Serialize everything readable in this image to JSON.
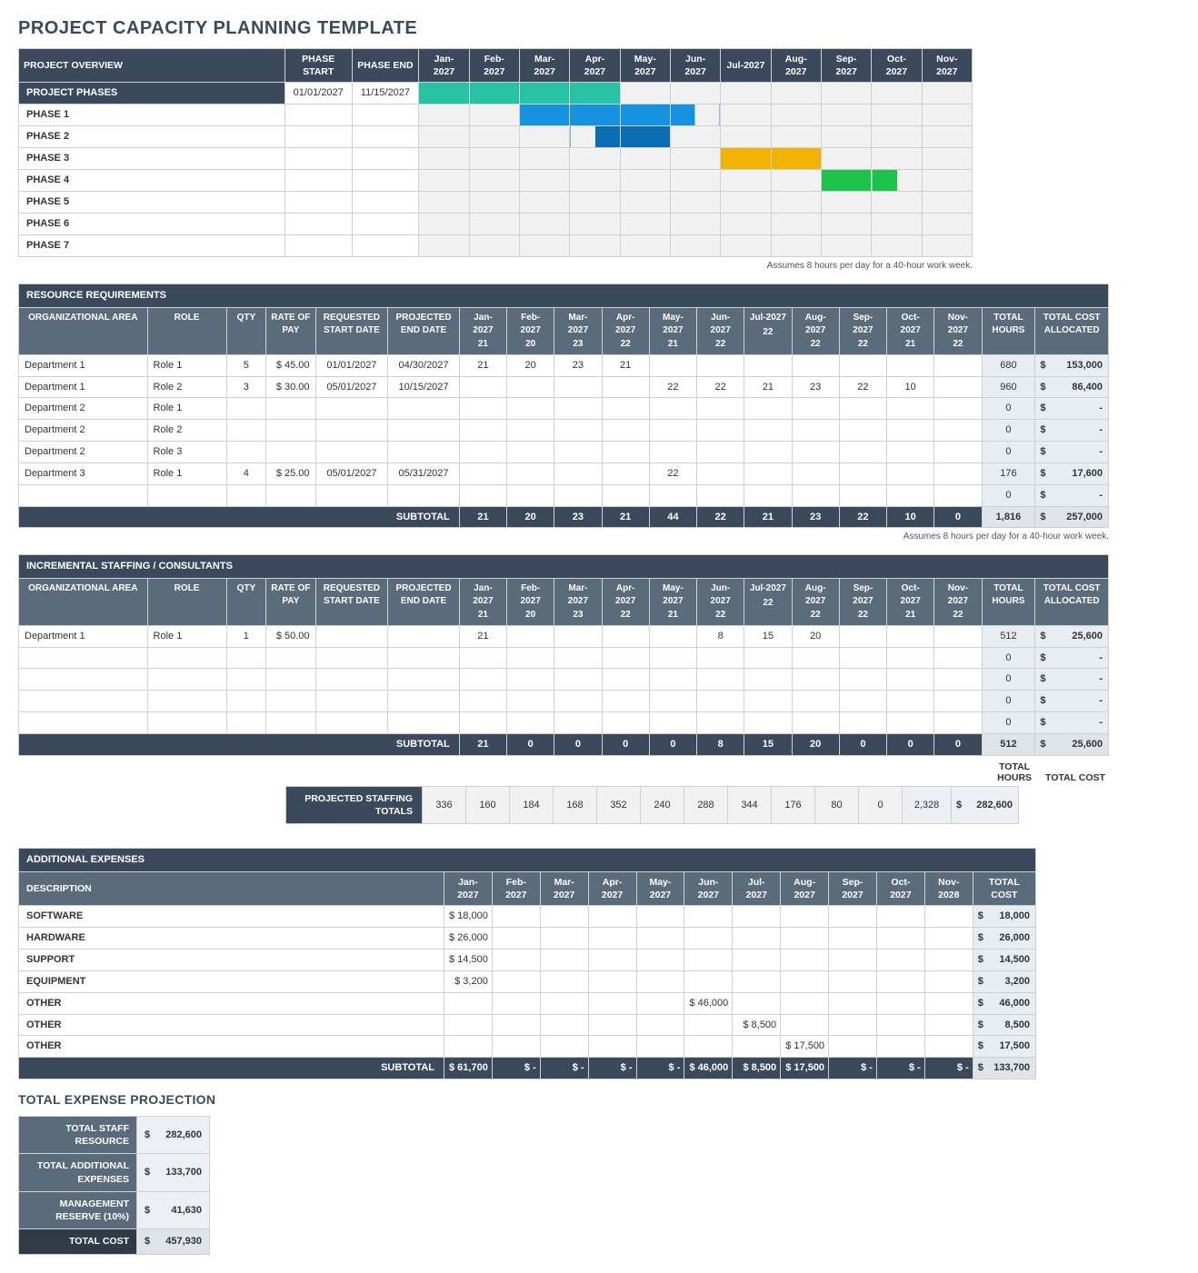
{
  "title": "PROJECT CAPACITY PLANNING TEMPLATE",
  "note": "Assumes 8 hours per day for a 40-hour work week.",
  "overview": {
    "headers": {
      "label": "PROJECT OVERVIEW",
      "phase_start": "PHASE START",
      "phase_end": "PHASE END"
    },
    "months": [
      "Jan-2027",
      "Feb-2027",
      "Mar-2027",
      "Apr-2027",
      "May-2027",
      "Jun-2027",
      "Jul-2027",
      "Aug-2027",
      "Sep-2027",
      "Oct-2027",
      "Nov-2027"
    ],
    "rows": [
      {
        "label": "PROJECT PHASES",
        "pp": true,
        "start": "01/01/2027",
        "end": "11/15/2027",
        "bars": [
          {
            "c": "teal",
            "f": "f"
          },
          {
            "c": "teal",
            "f": "f"
          },
          {
            "c": "teal",
            "f": "f"
          },
          {
            "c": "teal",
            "f": "f"
          },
          null,
          null,
          null,
          null,
          null,
          null,
          null
        ]
      },
      {
        "label": "PHASE 1",
        "bars": [
          null,
          null,
          {
            "c": "blue",
            "f": "f"
          },
          {
            "c": "blue",
            "f": "f"
          },
          {
            "c": "blue",
            "f": "f"
          },
          {
            "c": "blue",
            "f": "hl"
          },
          null,
          null,
          null,
          null,
          null
        ]
      },
      {
        "label": "PHASE 2",
        "bars": [
          null,
          null,
          null,
          {
            "c": "dblue",
            "f": "hr"
          },
          {
            "c": "dblue",
            "f": "f"
          },
          null,
          null,
          null,
          null,
          null,
          null
        ]
      },
      {
        "label": "PHASE 3",
        "bars": [
          null,
          null,
          null,
          null,
          null,
          null,
          {
            "c": "yel",
            "f": "f"
          },
          {
            "c": "yel",
            "f": "f"
          },
          null,
          null,
          null
        ]
      },
      {
        "label": "PHASE 4",
        "bars": [
          null,
          null,
          null,
          null,
          null,
          null,
          null,
          null,
          {
            "c": "grn",
            "f": "f"
          },
          {
            "c": "grn",
            "f": "hl"
          },
          null
        ]
      },
      {
        "label": "PHASE 5",
        "bars": [
          null,
          null,
          null,
          null,
          null,
          null,
          null,
          null,
          null,
          null,
          null
        ]
      },
      {
        "label": "PHASE 6",
        "bars": [
          null,
          null,
          null,
          null,
          null,
          null,
          null,
          null,
          null,
          null,
          null
        ]
      },
      {
        "label": "PHASE 7",
        "bars": [
          null,
          null,
          null,
          null,
          null,
          null,
          null,
          null,
          null,
          null,
          null
        ]
      }
    ]
  },
  "resource": {
    "section": "RESOURCE REQUIREMENTS",
    "headers": {
      "oa": "ORGANIZATIONAL AREA",
      "role": "ROLE",
      "qty": "QTY",
      "rate": "RATE OF PAY",
      "req": "REQUESTED START DATE",
      "proj": "PROJECTED END DATE",
      "th": "TOTAL HOURS",
      "tc": "TOTAL COST ALLOCATED"
    },
    "months": [
      {
        "m": "Jan-2027",
        "d": "21"
      },
      {
        "m": "Feb-2027",
        "d": "20"
      },
      {
        "m": "Mar-2027",
        "d": "23"
      },
      {
        "m": "Apr-2027",
        "d": "22"
      },
      {
        "m": "May-2027",
        "d": "21"
      },
      {
        "m": "Jun-2027",
        "d": "22"
      },
      {
        "m": "Jul-2027",
        "d": "22"
      },
      {
        "m": "Aug-2027",
        "d": "22"
      },
      {
        "m": "Sep-2027",
        "d": "22"
      },
      {
        "m": "Oct-2027",
        "d": "21"
      },
      {
        "m": "Nov-2027",
        "d": "22"
      }
    ],
    "rows": [
      {
        "oa": "Department 1",
        "role": "Role 1",
        "qty": "5",
        "rate": "$ 45.00",
        "req": "01/01/2027",
        "proj": "04/30/2027",
        "m": [
          "21",
          "20",
          "23",
          "21",
          "",
          "",
          "",
          "",
          "",
          "",
          ""
        ],
        "th": "680",
        "tc": "153,000"
      },
      {
        "oa": "Department 1",
        "role": "Role 2",
        "qty": "3",
        "rate": "$ 30.00",
        "req": "05/01/2027",
        "proj": "10/15/2027",
        "m": [
          "",
          "",
          "",
          "",
          "22",
          "22",
          "21",
          "23",
          "22",
          "10",
          ""
        ],
        "th": "960",
        "tc": "86,400"
      },
      {
        "oa": "Department 2",
        "role": "Role 1",
        "qty": "",
        "rate": "",
        "req": "",
        "proj": "",
        "m": [
          "",
          "",
          "",
          "",
          "",
          "",
          "",
          "",
          "",
          "",
          ""
        ],
        "th": "0",
        "tc": "-"
      },
      {
        "oa": "Department 2",
        "role": "Role 2",
        "qty": "",
        "rate": "",
        "req": "",
        "proj": "",
        "m": [
          "",
          "",
          "",
          "",
          "",
          "",
          "",
          "",
          "",
          "",
          ""
        ],
        "th": "0",
        "tc": "-"
      },
      {
        "oa": "Department 2",
        "role": "Role 3",
        "qty": "",
        "rate": "",
        "req": "",
        "proj": "",
        "m": [
          "",
          "",
          "",
          "",
          "",
          "",
          "",
          "",
          "",
          "",
          ""
        ],
        "th": "0",
        "tc": "-"
      },
      {
        "oa": "Department 3",
        "role": "Role 1",
        "qty": "4",
        "rate": "$ 25.00",
        "req": "05/01/2027",
        "proj": "05/31/2027",
        "m": [
          "",
          "",
          "",
          "",
          "22",
          "",
          "",
          "",
          "",
          "",
          ""
        ],
        "th": "176",
        "tc": "17,600"
      },
      {
        "oa": "",
        "role": "",
        "qty": "",
        "rate": "",
        "req": "",
        "proj": "",
        "m": [
          "",
          "",
          "",
          "",
          "",
          "",
          "",
          "",
          "",
          "",
          ""
        ],
        "th": "0",
        "tc": "-"
      }
    ],
    "subtotal": {
      "label": "SUBTOTAL",
      "m": [
        "21",
        "20",
        "23",
        "21",
        "44",
        "22",
        "21",
        "23",
        "22",
        "10",
        "0"
      ],
      "th": "1,816",
      "tc": "257,000"
    }
  },
  "staffing": {
    "section": "INCREMENTAL STAFFING / CONSULTANTS",
    "rows": [
      {
        "oa": "Department 1",
        "role": "Role 1",
        "qty": "1",
        "rate": "$ 50.00",
        "req": "",
        "proj": "",
        "m": [
          "21",
          "",
          "",
          "",
          "",
          "8",
          "15",
          "20",
          "",
          "",
          ""
        ],
        "th": "512",
        "tc": "25,600"
      },
      {
        "oa": "",
        "role": "",
        "qty": "",
        "rate": "",
        "req": "",
        "proj": "",
        "m": [
          "",
          "",
          "",
          "",
          "",
          "",
          "",
          "",
          "",
          "",
          ""
        ],
        "th": "0",
        "tc": "-"
      },
      {
        "oa": "",
        "role": "",
        "qty": "",
        "rate": "",
        "req": "",
        "proj": "",
        "m": [
          "",
          "",
          "",
          "",
          "",
          "",
          "",
          "",
          "",
          "",
          ""
        ],
        "th": "0",
        "tc": "-"
      },
      {
        "oa": "",
        "role": "",
        "qty": "",
        "rate": "",
        "req": "",
        "proj": "",
        "m": [
          "",
          "",
          "",
          "",
          "",
          "",
          "",
          "",
          "",
          "",
          ""
        ],
        "th": "0",
        "tc": "-"
      },
      {
        "oa": "",
        "role": "",
        "qty": "",
        "rate": "",
        "req": "",
        "proj": "",
        "m": [
          "",
          "",
          "",
          "",
          "",
          "",
          "",
          "",
          "",
          "",
          ""
        ],
        "th": "0",
        "tc": "-"
      }
    ],
    "subtotal": {
      "label": "SUBTOTAL",
      "m": [
        "21",
        "0",
        "0",
        "0",
        "0",
        "8",
        "15",
        "20",
        "0",
        "0",
        "0"
      ],
      "th": "512",
      "tc": "25,600"
    }
  },
  "projected": {
    "thLabel": "TOTAL HOURS",
    "tcLabel": "TOTAL COST",
    "label": "PROJECTED STAFFING TOTALS",
    "m": [
      "336",
      "160",
      "184",
      "168",
      "352",
      "240",
      "288",
      "344",
      "176",
      "80",
      "0"
    ],
    "th": "2,328",
    "tc": "282,600"
  },
  "expenses": {
    "section": "ADDITIONAL EXPENSES",
    "headers": {
      "desc": "DESCRIPTION",
      "tc": "TOTAL COST"
    },
    "months": [
      "Jan-2027",
      "Feb-2027",
      "Mar-2027",
      "Apr-2027",
      "May-2027",
      "Jun-2027",
      "Jul-2027",
      "Aug-2027",
      "Sep-2027",
      "Oct-2027",
      "Nov-2028"
    ],
    "rows": [
      {
        "d": "SOFTWARE",
        "m": [
          "$ 18,000",
          "",
          "",
          "",
          "",
          "",
          "",
          "",
          "",
          "",
          ""
        ],
        "tc": "18,000"
      },
      {
        "d": "HARDWARE",
        "m": [
          "$ 26,000",
          "",
          "",
          "",
          "",
          "",
          "",
          "",
          "",
          "",
          ""
        ],
        "tc": "26,000"
      },
      {
        "d": "SUPPORT",
        "m": [
          "$ 14,500",
          "",
          "",
          "",
          "",
          "",
          "",
          "",
          "",
          "",
          ""
        ],
        "tc": "14,500"
      },
      {
        "d": "EQUIPMENT",
        "m": [
          "$   3,200",
          "",
          "",
          "",
          "",
          "",
          "",
          "",
          "",
          "",
          ""
        ],
        "tc": "3,200"
      },
      {
        "d": "OTHER",
        "m": [
          "",
          "",
          "",
          "",
          "",
          "$ 46,000",
          "",
          "",
          "",
          "",
          ""
        ],
        "tc": "46,000"
      },
      {
        "d": "OTHER",
        "m": [
          "",
          "",
          "",
          "",
          "",
          "",
          "$  8,500",
          "",
          "",
          "",
          ""
        ],
        "tc": "8,500"
      },
      {
        "d": "OTHER",
        "m": [
          "",
          "",
          "",
          "",
          "",
          "",
          "",
          "$ 17,500",
          "",
          "",
          ""
        ],
        "tc": "17,500"
      }
    ],
    "subtotal": {
      "label": "SUBTOTAL",
      "m": [
        "$ 61,700",
        "$      -",
        "$      -",
        "$      -",
        "$      -",
        "$ 46,000",
        "$  8,500",
        "$ 17,500",
        "$      -",
        "$      -",
        "$      -"
      ],
      "tc": "133,700"
    }
  },
  "tep": {
    "title": "TOTAL EXPENSE PROJECTION",
    "rows": [
      {
        "k": "TOTAL STAFF RESOURCE",
        "v": "282,600"
      },
      {
        "k": "TOTAL ADDITIONAL EXPENSES",
        "v": "133,700"
      },
      {
        "k": "MANAGEMENT RESERVE (10%)",
        "v": "41,630"
      }
    ],
    "total": {
      "k": "TOTAL COST",
      "v": "457,930"
    }
  }
}
